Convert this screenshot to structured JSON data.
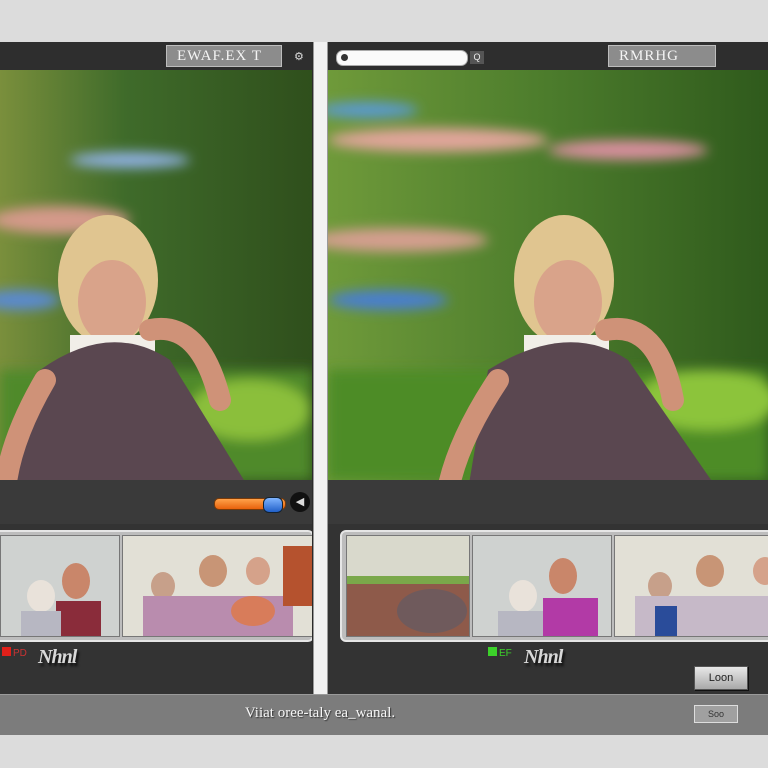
{
  "left_panel": {
    "title": "EWAF.EX T",
    "corner_icon": "gear-icon",
    "flags_label": "PD",
    "wordmark": "Nhnl"
  },
  "right_panel": {
    "title": "RMRHG",
    "search": {
      "placeholder": "",
      "button_label": "Q"
    },
    "flags_label": "EF",
    "wordmark": "Nhnl",
    "done_button_label": "Loon"
  },
  "status_bar": {
    "text": "Viiat oree-taly ea_wanal.",
    "button_label": "Soo"
  },
  "colors": {
    "slider_fill": "#e8620c",
    "slider_knob": "#2160c8",
    "status_bg": "#7c7c7c"
  }
}
